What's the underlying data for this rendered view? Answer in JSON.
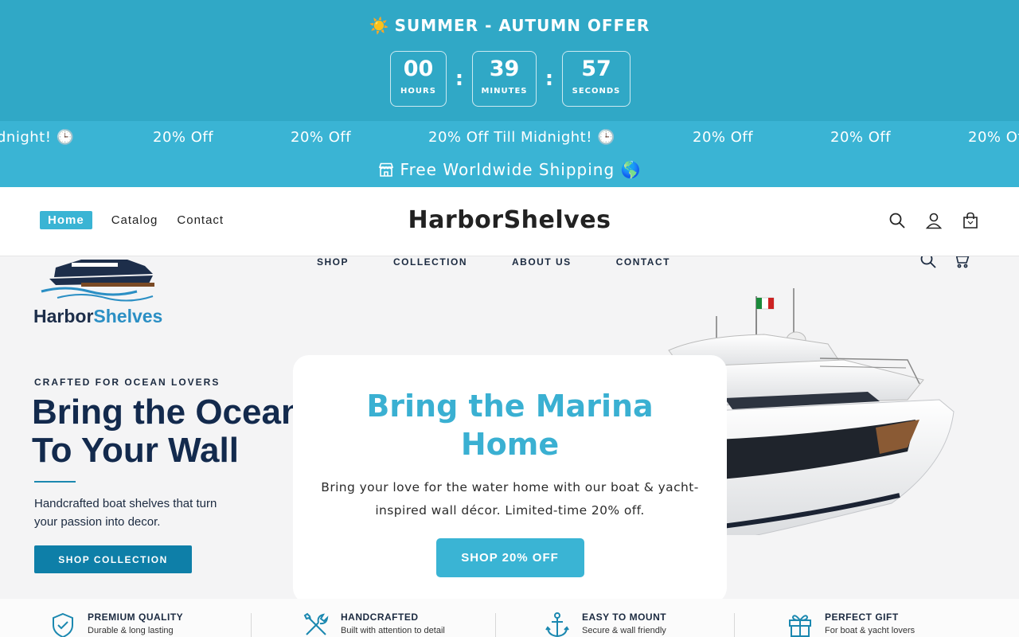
{
  "offer": {
    "sun_icon": "sun-icon",
    "title": "SUMMER - AUTUMN OFFER",
    "countdown": [
      {
        "value": "00",
        "label": "HOURS"
      },
      {
        "value": "39",
        "label": "MINUTES"
      },
      {
        "value": "57",
        "label": "SECONDS"
      }
    ],
    "separator": ":",
    "bg_color": "#30a8c6"
  },
  "ticker": {
    "items": [
      "dnight! 🕒",
      "20% Off",
      "20% Off",
      "20% Off Till Midnight! 🕒",
      "20% Off",
      "20% Off",
      "20% Of"
    ],
    "shipping_text": "Free Worldwide Shipping 🌎",
    "shipping_icon": "store-icon",
    "bg_color": "#3ab4d4"
  },
  "header": {
    "nav": [
      "Home",
      "Catalog",
      "Contact"
    ],
    "active": "Home",
    "logo": "HarborShelves",
    "icons": [
      "search-icon",
      "account-icon",
      "cart-bag-icon"
    ]
  },
  "hero": {
    "brand_a": "Harbor",
    "brand_b": "Shelves",
    "nav": [
      "SHOP",
      "COLLECTION",
      "ABOUT US",
      "CONTACT"
    ],
    "eyebrow": "CRAFTED FOR OCEAN LOVERS",
    "headline_line1": "Bring the Ocean",
    "headline_line2": "To Your Wall",
    "subtext": "Handcrafted boat shelves that turn your passion into decor.",
    "button": "SHOP COLLECTION"
  },
  "popup": {
    "title": "Bring the Marina Home",
    "text": "Bring your love for the water home with our boat & yacht-inspired wall décor. Limited-time 20% off.",
    "button": "SHOP 20% OFF",
    "accent": "#3ab0d2"
  },
  "features": [
    {
      "title": "PREMIUM QUALITY",
      "desc": "Durable & long lasting",
      "icon": "shield-check-icon"
    },
    {
      "title": "HANDCRAFTED",
      "desc": "Built with attention to detail",
      "icon": "tools-icon"
    },
    {
      "title": "EASY TO MOUNT",
      "desc": "Secure & wall friendly",
      "icon": "anchor-icon"
    },
    {
      "title": "PERFECT GIFT",
      "desc": "For boat & yacht lovers",
      "icon": "gift-icon"
    }
  ]
}
